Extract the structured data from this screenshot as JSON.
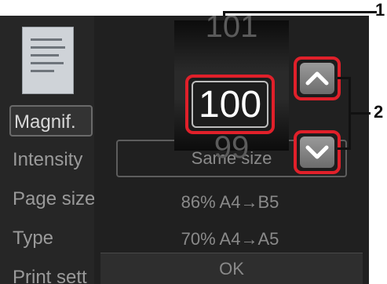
{
  "left_menu": {
    "items": [
      {
        "label": "Magnif."
      },
      {
        "label": "Intensity"
      },
      {
        "label": "Page size"
      },
      {
        "label": "Type"
      },
      {
        "label": "Print sett"
      }
    ]
  },
  "right_list": {
    "rows": [
      {
        "label": "Same size"
      },
      {
        "label": "86% A4→B5"
      },
      {
        "label": "70% A4→A5"
      }
    ],
    "ok_label": "OK"
  },
  "drum": {
    "prev_value": "101",
    "current_value": "100",
    "next_value": "99"
  },
  "callouts": {
    "one": "1",
    "two": "2"
  },
  "colors": {
    "highlight": "#e0202a"
  }
}
